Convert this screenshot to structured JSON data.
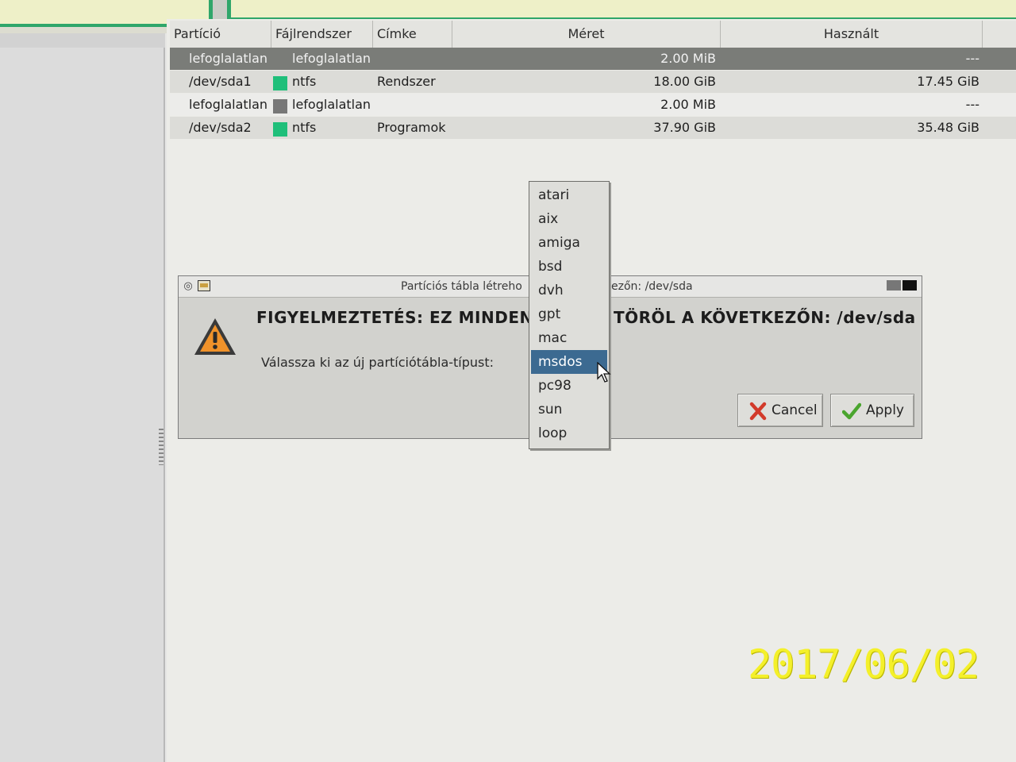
{
  "table": {
    "columns": [
      "Partíció",
      "Fájlrendszer",
      "Címke",
      "Méret",
      "Használt"
    ],
    "rows": [
      {
        "partition": "lefoglalatlan",
        "filesystem": "lefoglalatlan",
        "label": "",
        "size": "2.00 MiB",
        "used": "---",
        "fs_color": "#7a7c78",
        "selected": true
      },
      {
        "partition": "/dev/sda1",
        "filesystem": "ntfs",
        "label": "Rendszer",
        "size": "18.00 GiB",
        "used": "17.45 GiB",
        "fs_color": "#1fbf7a",
        "selected": false
      },
      {
        "partition": "lefoglalatlan",
        "filesystem": "lefoglalatlan",
        "label": "",
        "size": "2.00 MiB",
        "used": "---",
        "fs_color": "#777777",
        "selected": false
      },
      {
        "partition": "/dev/sda2",
        "filesystem": "ntfs",
        "label": "Programok",
        "size": "37.90 GiB",
        "used": "35.48 GiB",
        "fs_color": "#1fbf7a",
        "selected": false
      }
    ]
  },
  "dialog": {
    "title_left": "Partíciós tábla létreho",
    "title_right": "ezőn: /dev/sda",
    "warning_left": "FIGYELMEZTETÉS: EZ MINDEN",
    "warning_right": "TÖRÖL A KÖVETKEZŐN: /dev/sda",
    "prompt": "Válassza ki az új partíciótábla-típust:",
    "cancel_label": "Cancel",
    "apply_label": "Apply",
    "icons": [
      "app-menu-icon",
      "window-icon",
      "warning-icon",
      "cancel-x-icon",
      "apply-check-icon"
    ]
  },
  "dropdown": {
    "options": [
      "atari",
      "aix",
      "amiga",
      "bsd",
      "dvh",
      "gpt",
      "mac",
      "msdos",
      "pc98",
      "sun",
      "loop"
    ],
    "selected": "msdos"
  },
  "timestamp": "2017/06/02",
  "colors": {
    "selection": "#3c6a91",
    "ntfs": "#1fbf7a",
    "partition_bar_border": "#2fa66a",
    "timestamp": "#f4f02a"
  }
}
